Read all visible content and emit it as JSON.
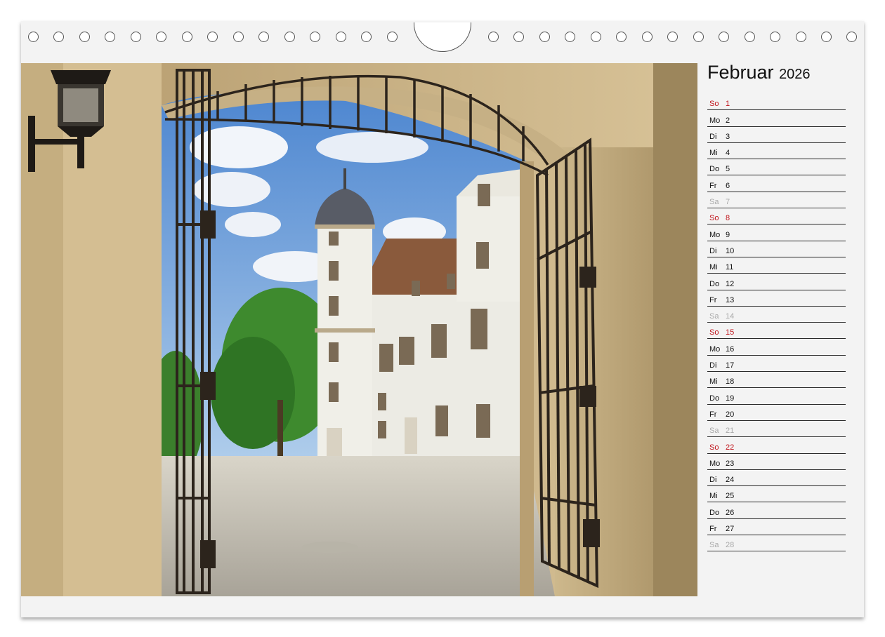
{
  "month": {
    "name": "Februar",
    "year": "2026"
  },
  "days": [
    {
      "dn": "So",
      "d": "1",
      "t": "sun"
    },
    {
      "dn": "Mo",
      "d": "2",
      "t": ""
    },
    {
      "dn": "Di",
      "d": "3",
      "t": ""
    },
    {
      "dn": "Mi",
      "d": "4",
      "t": ""
    },
    {
      "dn": "Do",
      "d": "5",
      "t": ""
    },
    {
      "dn": "Fr",
      "d": "6",
      "t": ""
    },
    {
      "dn": "Sa",
      "d": "7",
      "t": "sat"
    },
    {
      "dn": "So",
      "d": "8",
      "t": "sun"
    },
    {
      "dn": "Mo",
      "d": "9",
      "t": ""
    },
    {
      "dn": "Di",
      "d": "10",
      "t": ""
    },
    {
      "dn": "Mi",
      "d": "11",
      "t": ""
    },
    {
      "dn": "Do",
      "d": "12",
      "t": ""
    },
    {
      "dn": "Fr",
      "d": "13",
      "t": ""
    },
    {
      "dn": "Sa",
      "d": "14",
      "t": "sat"
    },
    {
      "dn": "So",
      "d": "15",
      "t": "sun"
    },
    {
      "dn": "Mo",
      "d": "16",
      "t": ""
    },
    {
      "dn": "Di",
      "d": "17",
      "t": ""
    },
    {
      "dn": "Mi",
      "d": "18",
      "t": ""
    },
    {
      "dn": "Do",
      "d": "19",
      "t": ""
    },
    {
      "dn": "Fr",
      "d": "20",
      "t": ""
    },
    {
      "dn": "Sa",
      "d": "21",
      "t": "sat"
    },
    {
      "dn": "So",
      "d": "22",
      "t": "sun"
    },
    {
      "dn": "Mo",
      "d": "23",
      "t": ""
    },
    {
      "dn": "Di",
      "d": "24",
      "t": ""
    },
    {
      "dn": "Mi",
      "d": "25",
      "t": ""
    },
    {
      "dn": "Do",
      "d": "26",
      "t": ""
    },
    {
      "dn": "Fr",
      "d": "27",
      "t": ""
    },
    {
      "dn": "Sa",
      "d": "28",
      "t": "sat"
    }
  ],
  "colors": {
    "sunday": "#c0141b",
    "saturday": "#aaaaaa",
    "text": "#111111"
  }
}
